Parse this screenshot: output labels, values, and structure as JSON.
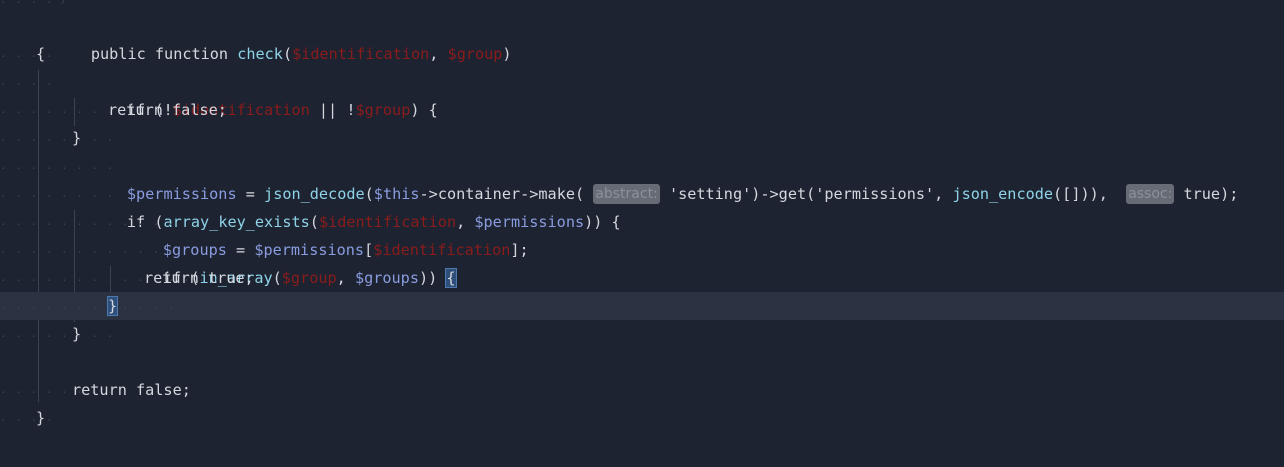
{
  "editor": {
    "lines": [
      {
        "id": "l0",
        "top": 0
      },
      {
        "id": "l1"
      }
    ],
    "hints": {
      "abstract": "abstract:",
      "assoc": "assoc:"
    },
    "tokens": {
      "public": "public",
      "function": "function",
      "check": "check",
      "p_ident": "$identification",
      "p_group": "$group",
      "v_permissions": "$permissions",
      "v_this": "$this",
      "v_groups": "$groups",
      "json_decode": "json_decode",
      "json_encode": "json_encode",
      "array_key_exists": "array_key_exists",
      "in_array": "in_array",
      "container": "container",
      "make": "make",
      "get": "get",
      "setting": "'setting'",
      "permissions_str": "'permissions'",
      "ret_false": "return false;",
      "ret_true": "return true;",
      "if_kw": "if",
      "true_kw": "true"
    }
  }
}
